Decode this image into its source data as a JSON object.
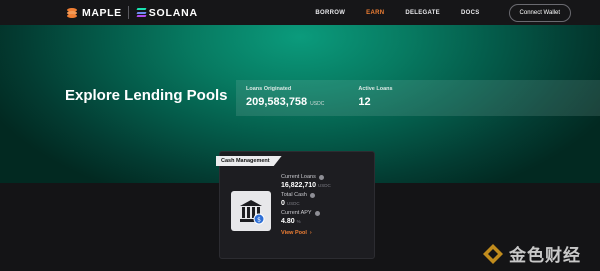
{
  "header": {
    "brand_name": "MAPLE",
    "network_name": "SOLANA",
    "nav": [
      {
        "label": "BORROW",
        "active": false
      },
      {
        "label": "EARN",
        "active": true
      },
      {
        "label": "DELEGATE",
        "active": false
      },
      {
        "label": "DOCS",
        "active": false
      }
    ],
    "connect_label": "Connect Wallet"
  },
  "hero": {
    "title": "Explore Lending Pools",
    "stats": {
      "loans_originated_label": "Loans Originated",
      "loans_originated_value": "209,583,758",
      "loans_originated_unit": "USDC",
      "active_loans_label": "Active Loans",
      "active_loans_value": "12"
    }
  },
  "pool_card": {
    "tag": "Cash Management",
    "current_loans_label": "Current Loans",
    "current_loans_value": "16,822,710",
    "current_loans_unit": "USDC",
    "total_cash_label": "Total Cash",
    "total_cash_value": "0",
    "total_cash_unit": "USDC",
    "current_apy_label": "Current APY",
    "current_apy_value": "4.80",
    "current_apy_unit": "%",
    "view_pool_label": "View Pool"
  },
  "watermark": {
    "text": "金色财经"
  },
  "colors": {
    "accent": "#f07f34",
    "hero_green": "#077a61",
    "background": "#141416"
  }
}
